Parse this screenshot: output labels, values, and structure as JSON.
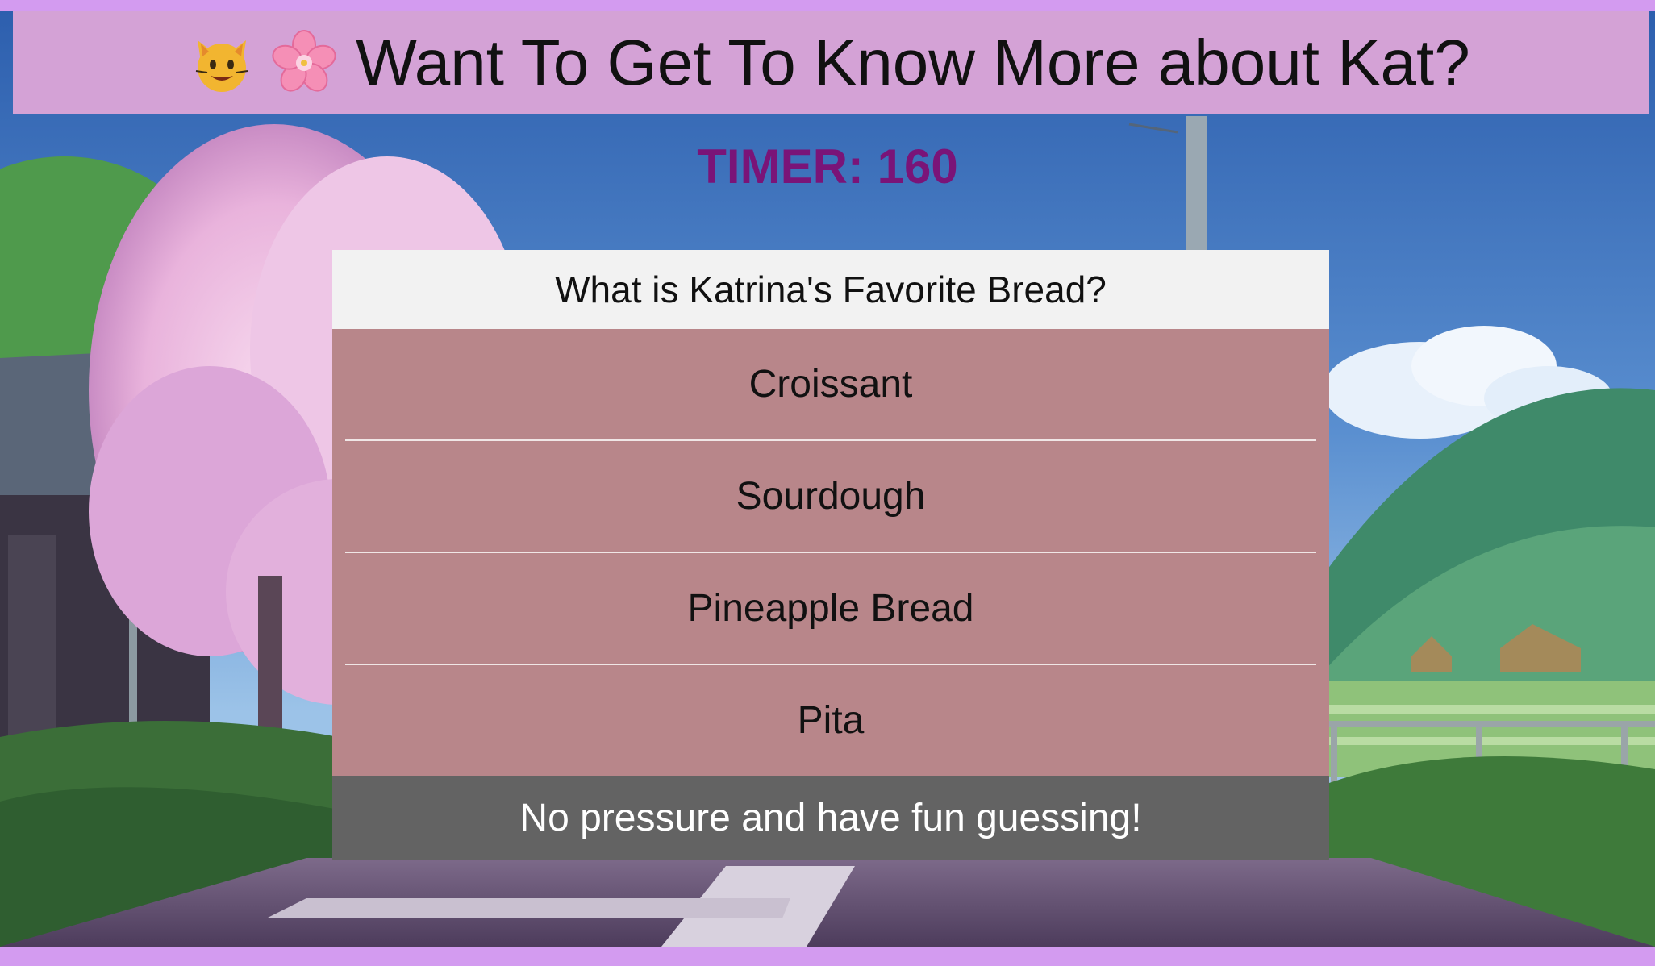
{
  "header": {
    "icons": [
      "cat-face-icon",
      "cherry-blossom-icon"
    ],
    "title": "Want To Get To Know More about Kat?"
  },
  "timer": {
    "text": "TIMER: 160"
  },
  "quiz": {
    "question": "What is Katrina's Favorite Bread?",
    "answers": [
      {
        "label": "Croissant"
      },
      {
        "label": "Sourdough"
      },
      {
        "label": "Pineapple Bread"
      },
      {
        "label": "Pita"
      }
    ],
    "footer": "No pressure and have fun guessing!"
  },
  "colors": {
    "page_border": "#d39bf0",
    "header_bg": "#d4a2d6",
    "timer": "#7a1478",
    "question_bg": "#f2f2f2",
    "answers_bg": "#b8868a",
    "footer_bg": "#636363"
  }
}
